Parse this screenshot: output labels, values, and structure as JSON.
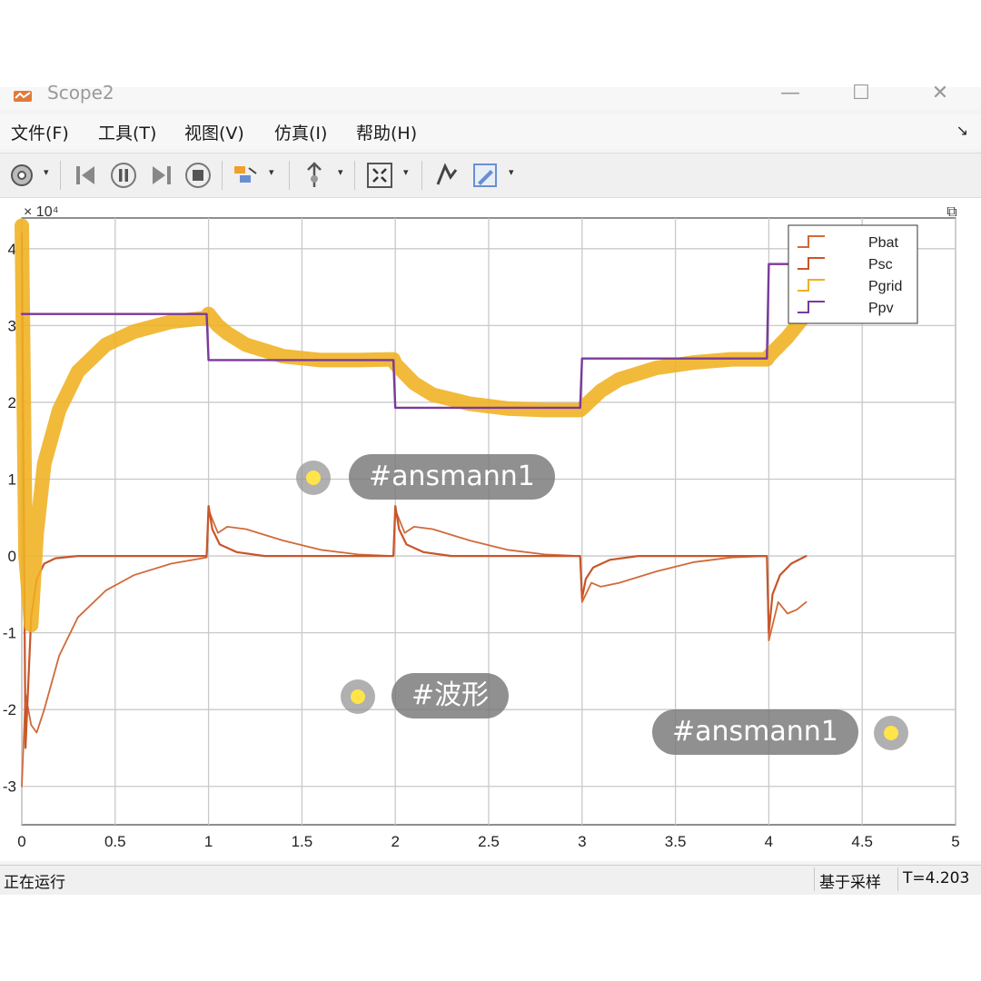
{
  "window": {
    "title": "Scope2",
    "min_glyph": "—",
    "max_glyph": "☐",
    "close_glyph": "✕"
  },
  "menu": {
    "items": [
      "文件(F)",
      "工具(T)",
      "视图(V)",
      "仿真(I)",
      "帮助(H)"
    ],
    "arrow": "↘"
  },
  "toolbar": {
    "icons": [
      "settings-icon",
      "step-back-icon",
      "pause-icon",
      "step-forward-icon",
      "stop-icon",
      "highlight-icon",
      "trigger-icon",
      "autoscale-icon",
      "style-icon",
      "edit-icon"
    ]
  },
  "plot": {
    "exponent_label": "× 10⁴",
    "corner_glyph": "⧉"
  },
  "chart_data": {
    "type": "line",
    "xlim": [
      0,
      5
    ],
    "ylim": [
      -3.5,
      4.4
    ],
    "y_scale_factor": "1e4",
    "grid": true,
    "legend_position": "top-right",
    "x_ticks": [
      "0",
      "0.5",
      "1",
      "1.5",
      "2",
      "2.5",
      "3",
      "3.5",
      "4",
      "4.5",
      "5"
    ],
    "y_ticks": [
      "-3",
      "-2",
      "-1",
      "0",
      "1",
      "2",
      "3",
      "4"
    ],
    "series": [
      {
        "name": "Pbat",
        "color": "#d06a3a",
        "x": [
          0,
          0.02,
          0.05,
          0.08,
          0.12,
          0.2,
          0.3,
          0.45,
          0.6,
          0.8,
          0.99,
          1.0,
          1.05,
          1.1,
          1.2,
          1.4,
          1.6,
          1.8,
          1.99,
          2.0,
          2.05,
          2.1,
          2.2,
          2.4,
          2.6,
          2.8,
          2.99,
          3.0,
          3.05,
          3.1,
          3.2,
          3.4,
          3.6,
          3.8,
          3.99,
          4.0,
          4.05,
          4.1,
          4.15,
          4.2
        ],
        "y": [
          -3.0,
          -1.8,
          -2.2,
          -2.3,
          -2.0,
          -1.3,
          -0.8,
          -0.45,
          -0.25,
          -0.1,
          -0.02,
          0.6,
          0.3,
          0.38,
          0.35,
          0.2,
          0.08,
          0.02,
          0.0,
          0.6,
          0.3,
          0.38,
          0.35,
          0.2,
          0.08,
          0.02,
          0.0,
          -0.6,
          -0.35,
          -0.4,
          -0.35,
          -0.2,
          -0.08,
          -0.02,
          0.0,
          -1.1,
          -0.6,
          -0.75,
          -0.7,
          -0.6
        ]
      },
      {
        "name": "Psc",
        "color": "#c8562a",
        "x": [
          0,
          0.02,
          0.05,
          0.08,
          0.12,
          0.18,
          0.3,
          0.5,
          0.99,
          1.0,
          1.02,
          1.06,
          1.15,
          1.3,
          1.99,
          2.0,
          2.02,
          2.06,
          2.15,
          2.3,
          2.99,
          3.0,
          3.02,
          3.06,
          3.15,
          3.3,
          3.99,
          4.0,
          4.02,
          4.06,
          4.12,
          4.2
        ],
        "y": [
          4.2,
          -2.5,
          -0.8,
          -0.3,
          -0.1,
          -0.03,
          0.0,
          0.0,
          0.0,
          0.65,
          0.35,
          0.15,
          0.05,
          0.0,
          0.0,
          0.65,
          0.35,
          0.15,
          0.05,
          0.0,
          0.0,
          -0.55,
          -0.3,
          -0.15,
          -0.05,
          0.0,
          0.0,
          -1.0,
          -0.5,
          -0.25,
          -0.1,
          0.0
        ]
      },
      {
        "name": "Pgrid",
        "color": "#f0b020",
        "x": [
          0,
          0.02,
          0.05,
          0.08,
          0.12,
          0.2,
          0.3,
          0.45,
          0.6,
          0.8,
          0.99,
          1.0,
          1.05,
          1.1,
          1.2,
          1.4,
          1.6,
          1.8,
          1.99,
          2.0,
          2.1,
          2.2,
          2.4,
          2.6,
          2.8,
          2.99,
          3.0,
          3.1,
          3.2,
          3.4,
          3.6,
          3.8,
          3.99,
          4.0,
          4.1,
          4.2
        ],
        "y": [
          4.3,
          0.0,
          -0.9,
          0.3,
          1.2,
          1.9,
          2.4,
          2.75,
          2.92,
          3.05,
          3.1,
          3.15,
          3.0,
          2.9,
          2.75,
          2.6,
          2.55,
          2.55,
          2.56,
          2.5,
          2.25,
          2.1,
          1.98,
          1.92,
          1.9,
          1.9,
          1.92,
          2.15,
          2.3,
          2.45,
          2.52,
          2.56,
          2.56,
          2.6,
          2.85,
          3.15
        ]
      },
      {
        "name": "Ppv",
        "color": "#7a3a9a",
        "x": [
          0,
          0.99,
          1.0,
          1.99,
          2.0,
          2.99,
          3.0,
          3.99,
          4.0,
          4.2
        ],
        "y": [
          3.15,
          3.15,
          2.55,
          2.55,
          1.93,
          1.93,
          2.57,
          2.57,
          3.8,
          3.8
        ]
      }
    ]
  },
  "watermarks": [
    "#ansmann1",
    "#波形",
    "#ansmann1"
  ],
  "status": {
    "left": "正在运行",
    "mode": "基于采样",
    "time": "T=4.203"
  }
}
